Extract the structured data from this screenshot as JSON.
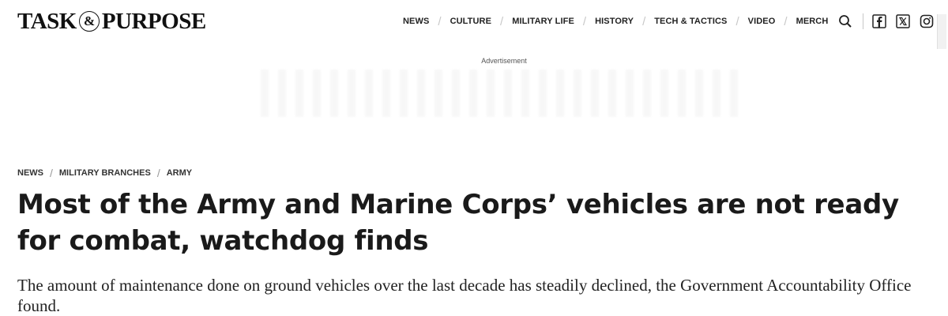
{
  "brand": {
    "left": "TASK",
    "amp": "&",
    "right": "PURPOSE"
  },
  "nav": {
    "items": [
      "NEWS",
      "CULTURE",
      "MILITARY LIFE",
      "HISTORY",
      "TECH & TACTICS",
      "VIDEO",
      "MERCH"
    ]
  },
  "icons": {
    "search": "search-icon",
    "social": [
      "facebook-icon",
      "x-icon",
      "instagram-icon"
    ]
  },
  "ad": {
    "label": "Advertisement"
  },
  "breadcrumb": [
    "NEWS",
    "MILITARY BRANCHES",
    "ARMY"
  ],
  "article": {
    "headline": "Most of the Army and Marine Corps’ vehicles are not ready for combat, watchdog finds",
    "dek": "The amount of maintenance done on ground vehicles over the last decade has steadily declined, the Government Accountability Office found."
  }
}
